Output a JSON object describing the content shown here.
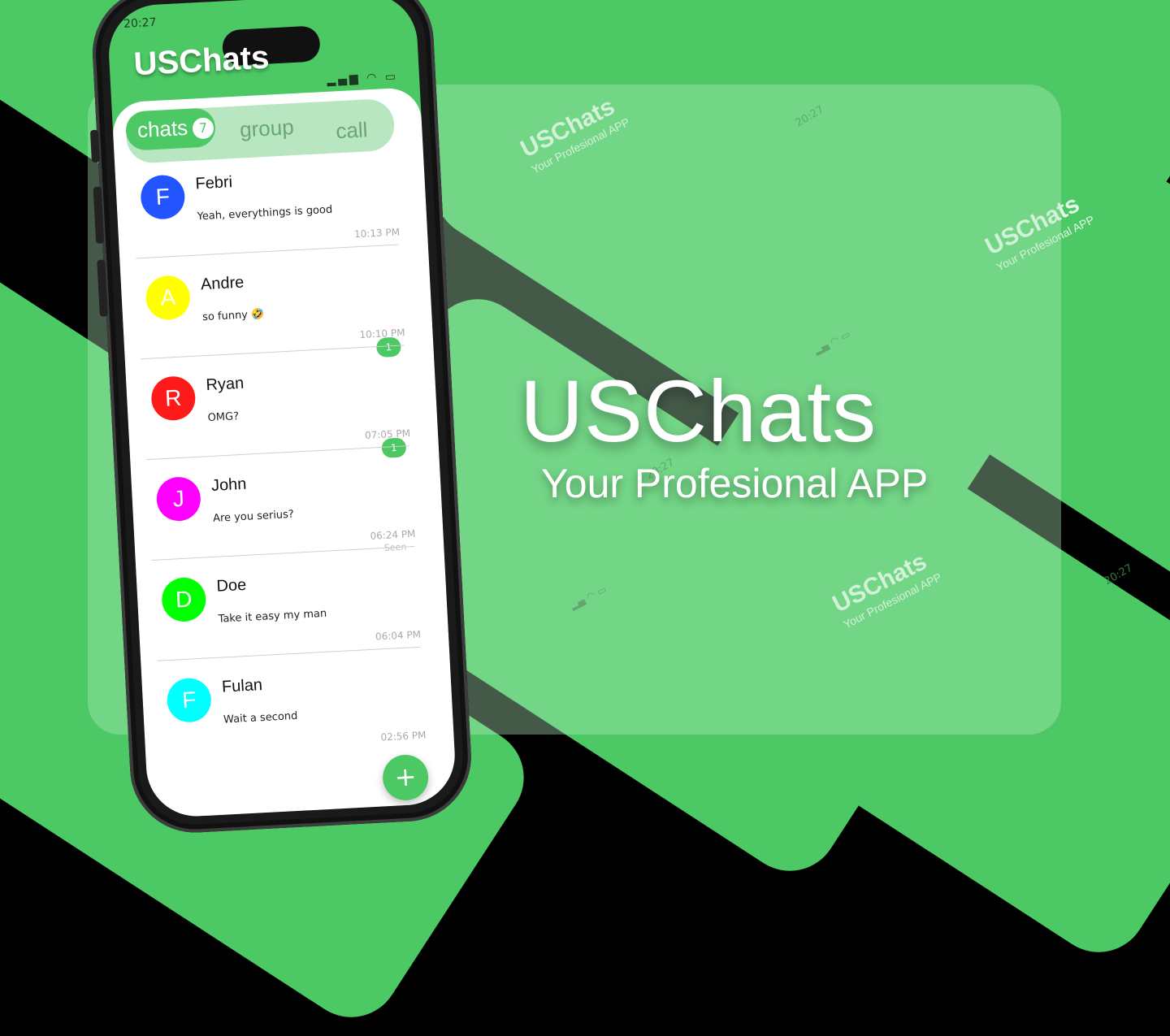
{
  "colors": {
    "brand_green": "#4cc964",
    "background": "#000000",
    "avatar_blue": "#2255ff",
    "avatar_yellow": "#ffff00",
    "avatar_red": "#ff1a1a",
    "avatar_magenta": "#ff00ff",
    "avatar_green": "#00ff00",
    "avatar_cyan": "#00ffff"
  },
  "hero": {
    "title": "USChats",
    "subtitle": "Your Profesional APP"
  },
  "tiles": {
    "time": "20:27",
    "brand": "USChats",
    "brand_sub": "Your Profesional APP"
  },
  "phone": {
    "status_time": "20:27",
    "app_title": "USChats",
    "icons": [
      "signal-icon",
      "wifi-icon",
      "battery-icon",
      "search-icon",
      "more-vert-icon"
    ],
    "tabs": [
      {
        "label": "chats",
        "badge": "7"
      },
      {
        "label": "group"
      },
      {
        "label": "call"
      }
    ],
    "chats": [
      {
        "initial": "F",
        "name": "Febri",
        "message": "Yeah, everythings is good",
        "time": "10:13 PM",
        "unread": "",
        "seen": ""
      },
      {
        "initial": "A",
        "name": "Andre",
        "message": "so funny 🤣",
        "time": "10:10 PM",
        "unread": "1",
        "seen": ""
      },
      {
        "initial": "R",
        "name": "Ryan",
        "message": "OMG?",
        "time": "07:05 PM",
        "unread": "1",
        "seen": ""
      },
      {
        "initial": "J",
        "name": "John",
        "message": "Are you serius?",
        "time": "06:24 PM",
        "unread": "",
        "seen": "Seen"
      },
      {
        "initial": "D",
        "name": "Doe",
        "message": "Take it easy my man",
        "time": "06:04 PM",
        "unread": "",
        "seen": ""
      },
      {
        "initial": "F",
        "name": "Fulan",
        "message": "Wait a second",
        "time": "02:56 PM",
        "unread": "",
        "seen": ""
      }
    ],
    "fab": "+"
  }
}
